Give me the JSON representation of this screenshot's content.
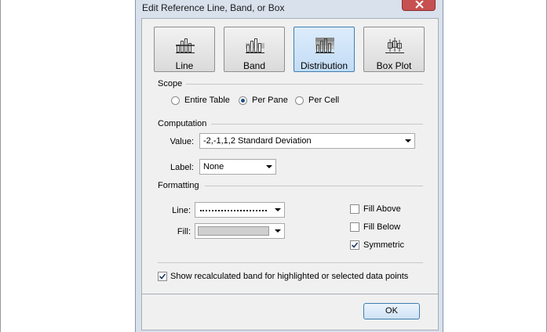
{
  "window": {
    "title": "Edit Reference Line, Band, or Box"
  },
  "types": [
    {
      "label": "Line",
      "selected": false
    },
    {
      "label": "Band",
      "selected": false
    },
    {
      "label": "Distribution",
      "selected": true
    },
    {
      "label": "Box Plot",
      "selected": false
    }
  ],
  "scope": {
    "heading": "Scope",
    "options": [
      "Entire Table",
      "Per Pane",
      "Per Cell"
    ],
    "selected": "Per Pane"
  },
  "computation": {
    "heading": "Computation",
    "value_label": "Value:",
    "value": "-2,-1,1,2 Standard Deviation",
    "label_label": "Label:",
    "label_value": "None"
  },
  "formatting": {
    "heading": "Formatting",
    "line_label": "Line:",
    "fill_label": "Fill:",
    "fill_color": "#cfcfcf",
    "fill_above": {
      "label": "Fill Above",
      "checked": false
    },
    "fill_below": {
      "label": "Fill Below",
      "checked": false
    },
    "symmetric": {
      "label": "Symmetric",
      "checked": true
    }
  },
  "show_recalculated": {
    "label": "Show recalculated band for highlighted or selected data points",
    "checked": true
  },
  "buttons": {
    "ok": "OK"
  },
  "colors": {
    "accent": "#3c7fb1",
    "close": "#c75050",
    "frame": "#d8e1ec"
  }
}
